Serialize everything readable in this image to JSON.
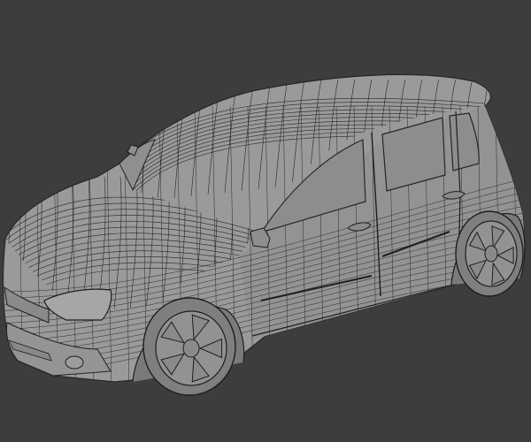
{
  "scene": {
    "background_color": "#3d3d3d",
    "body_fill": "#9a9a9a",
    "body_shade": "#858585",
    "glass_fill": "#8d8d8d",
    "wire_color": "#262626",
    "tire_fill": "#7f7f7f",
    "rim_fill": "#929292",
    "light_fill": "#a6a6a6",
    "icons": [
      "car-mesh",
      "wheel-rim",
      "door-handle",
      "side-mirror"
    ]
  }
}
